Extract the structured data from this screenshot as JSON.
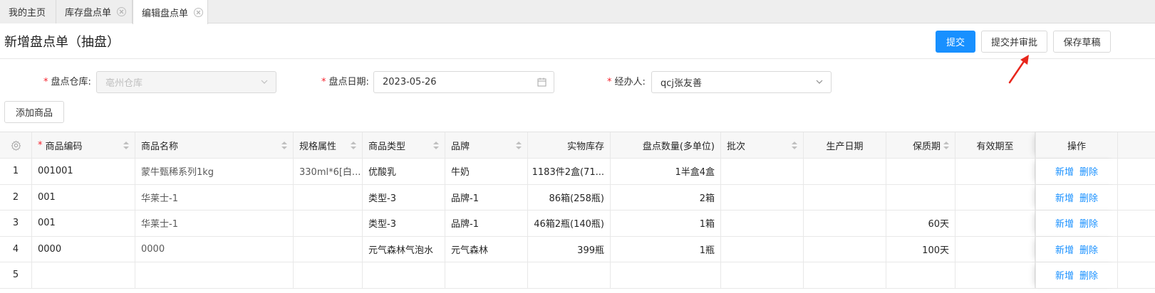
{
  "tabs": [
    {
      "label": "我的主页"
    },
    {
      "label": "库存盘点单"
    },
    {
      "label": "编辑盘点单"
    }
  ],
  "header": {
    "title": "新增盘点单（抽盘）",
    "submit_label": "提交",
    "submit_approve_label": "提交并审批",
    "save_draft_label": "保存草稿"
  },
  "form": {
    "warehouse": {
      "label": "盘点仓库:",
      "value": "亳州仓库"
    },
    "date": {
      "label": "盘点日期:",
      "value": "2023-05-26"
    },
    "handler": {
      "label": "经办人:",
      "value": "qcj张友善"
    },
    "add_product_label": "添加商品"
  },
  "table": {
    "columns": [
      "商品编码",
      "商品名称",
      "规格属性",
      "商品类型",
      "品牌",
      "实物库存",
      "盘点数量(多单位)",
      "批次",
      "生产日期",
      "保质期",
      "有效期至",
      "操作"
    ],
    "action_add": "新增",
    "action_delete": "删除",
    "rows": [
      {
        "no": "1",
        "code": "001001",
        "name": "蒙牛甄稀系列1kg",
        "spec": "330ml*6[白...",
        "type": "优酸乳",
        "brand": "牛奶",
        "stock": "1183件2盒(71...",
        "count": "1半盒4盒",
        "batch": "",
        "mfg": "",
        "shelf": "",
        "expiry": ""
      },
      {
        "no": "2",
        "code": "001",
        "name": "华莱士-1",
        "spec": "",
        "type": "类型-3",
        "brand": "品牌-1",
        "stock": "86箱(258瓶)",
        "count": "2箱",
        "batch": "",
        "mfg": "",
        "shelf": "",
        "expiry": ""
      },
      {
        "no": "3",
        "code": "001",
        "name": "华莱士-1",
        "spec": "",
        "type": "类型-3",
        "brand": "品牌-1",
        "stock": "46箱2瓶(140瓶)",
        "count": "1箱",
        "batch": "",
        "mfg": "",
        "shelf": "60天",
        "expiry": ""
      },
      {
        "no": "4",
        "code": "0000",
        "name": "0000",
        "spec": "",
        "type": "元气森林气泡水",
        "brand": "元气森林",
        "stock": "399瓶",
        "count": "1瓶",
        "batch": "",
        "mfg": "",
        "shelf": "100天",
        "expiry": ""
      },
      {
        "no": "5",
        "code": "",
        "name": "",
        "spec": "",
        "type": "",
        "brand": "",
        "stock": "",
        "count": "",
        "batch": "",
        "mfg": "",
        "shelf": "",
        "expiry": ""
      }
    ]
  },
  "colors": {
    "primary": "#1890ff",
    "required": "#f5222d",
    "arrow": "#e8261c"
  }
}
